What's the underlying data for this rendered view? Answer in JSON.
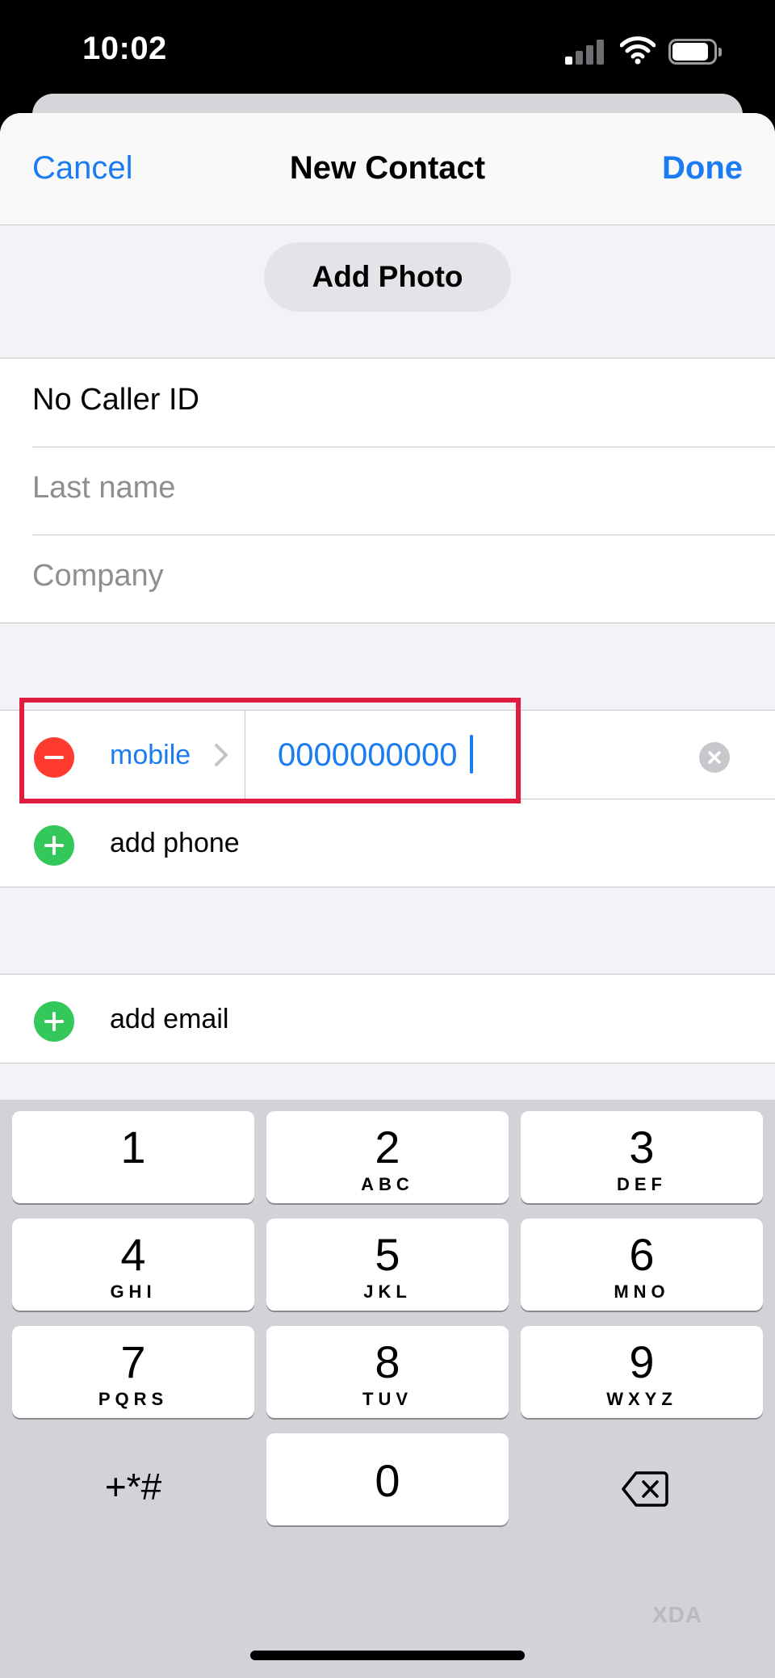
{
  "status_bar": {
    "time": "10:02",
    "signal_icon": "cellular-signal-icon",
    "wifi_icon": "wifi-icon",
    "battery_icon": "battery-icon"
  },
  "nav": {
    "cancel_label": "Cancel",
    "title": "New Contact",
    "done_label": "Done"
  },
  "add_photo_label": "Add Photo",
  "name_fields": {
    "first_name_value": "No Caller ID",
    "last_name_placeholder": "Last name",
    "company_placeholder": "Company"
  },
  "phone": {
    "label": "mobile",
    "value": "0000000000",
    "add_phone_label": "add phone"
  },
  "email": {
    "add_email_label": "add email"
  },
  "keypad": {
    "keys": [
      {
        "num": "1",
        "letters": ""
      },
      {
        "num": "2",
        "letters": "ABC"
      },
      {
        "num": "3",
        "letters": "DEF"
      },
      {
        "num": "4",
        "letters": "GHI"
      },
      {
        "num": "5",
        "letters": "JKL"
      },
      {
        "num": "6",
        "letters": "MNO"
      },
      {
        "num": "7",
        "letters": "PQRS"
      },
      {
        "num": "8",
        "letters": "TUV"
      },
      {
        "num": "9",
        "letters": "WXYZ"
      },
      {
        "num": "0",
        "letters": ""
      }
    ],
    "symbols_label": "+*#",
    "delete_icon": "backspace-icon"
  },
  "watermark": "XDA",
  "colors": {
    "accent": "#1a7cf0",
    "destructive": "#ff3b30",
    "add": "#34c759",
    "highlight_box": "#e11d3f"
  }
}
